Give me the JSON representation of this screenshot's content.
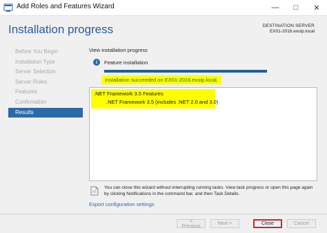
{
  "window": {
    "title": "Add Roles and Features Wizard",
    "minimize_glyph": "—",
    "maximize_glyph": "□",
    "close_glyph": "✕"
  },
  "header": {
    "title": "Installation progress",
    "destination_label": "DESTINATION SERVER",
    "destination_server": "EX01-2016.exoip.local"
  },
  "nav": {
    "items": [
      {
        "label": "Before You Begin",
        "active": false
      },
      {
        "label": "Installation Type",
        "active": false
      },
      {
        "label": "Server Selection",
        "active": false
      },
      {
        "label": "Server Roles",
        "active": false
      },
      {
        "label": "Features",
        "active": false
      },
      {
        "label": "Confirmation",
        "active": false
      },
      {
        "label": "Results",
        "active": true
      }
    ]
  },
  "main": {
    "section_label": "View installation progress",
    "info_icon": "info-icon",
    "feature_installation_label": "Feature installation",
    "progress": 1.0,
    "status_message": "Installation succeeded on EX01-2016.exoip.local.",
    "results": {
      "parent": ".NET Framework 3.5 Features",
      "child": ".NET Framework 3.5 (includes .NET 2.0 and 3.0)"
    },
    "notice_text": "You can close this wizard without interrupting running tasks. View task progress or open this page again by clicking Notifications in the command bar, and then Task Details.",
    "export_link": "Export configuration settings"
  },
  "buttons": {
    "previous": "< Previous",
    "next": "Next >",
    "close": "Close",
    "cancel": "Cancel"
  },
  "colors": {
    "title_blue": "#2a5aa0",
    "nav_active": "#2b6aa8",
    "highlight": "#ffff00",
    "success_text": "#2e6f22",
    "close_button_outline": "#e02020"
  }
}
